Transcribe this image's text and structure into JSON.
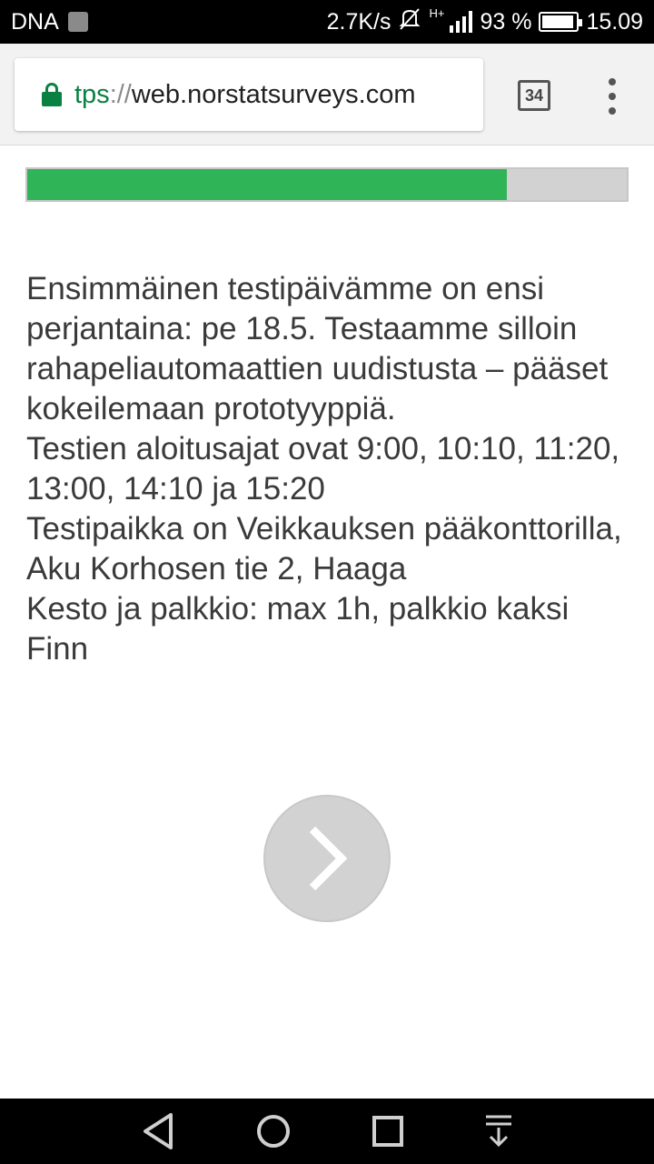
{
  "status_bar": {
    "carrier": "DNA",
    "network_speed": "2.7K/s",
    "network_type": "H+",
    "battery_percent": "93 %",
    "battery_level": 0.93,
    "time": "15.09"
  },
  "browser": {
    "url_scheme": "tps",
    "url_separator": "://",
    "url_host": "web.norstatsurveys.com",
    "tab_count": "34"
  },
  "survey": {
    "progress": 0.8,
    "progress_color": "#2fb457",
    "paragraphs": [
      "Ensimmäinen testipäivämme on ensi perjantaina: pe 18.5. Testaamme silloin rahapeliautomaattien uudistusta – pääset kokeilemaan prototyyppiä.",
      "Testien aloitusajat ovat 9:00, 10:10, 11:20, 13:00, 14:10 ja 15:20",
      "Testipaikka on Veikkauksen pääkonttorilla, Aku Korhosen tie 2, Haaga",
      "Kesto ja palkkio: max 1h, palkkio kaksi Finn"
    ],
    "next_icon": "chevron-right-icon"
  },
  "nav_bar": {
    "icons": [
      "back-icon",
      "home-icon",
      "recents-icon",
      "notification-pull-icon"
    ]
  }
}
